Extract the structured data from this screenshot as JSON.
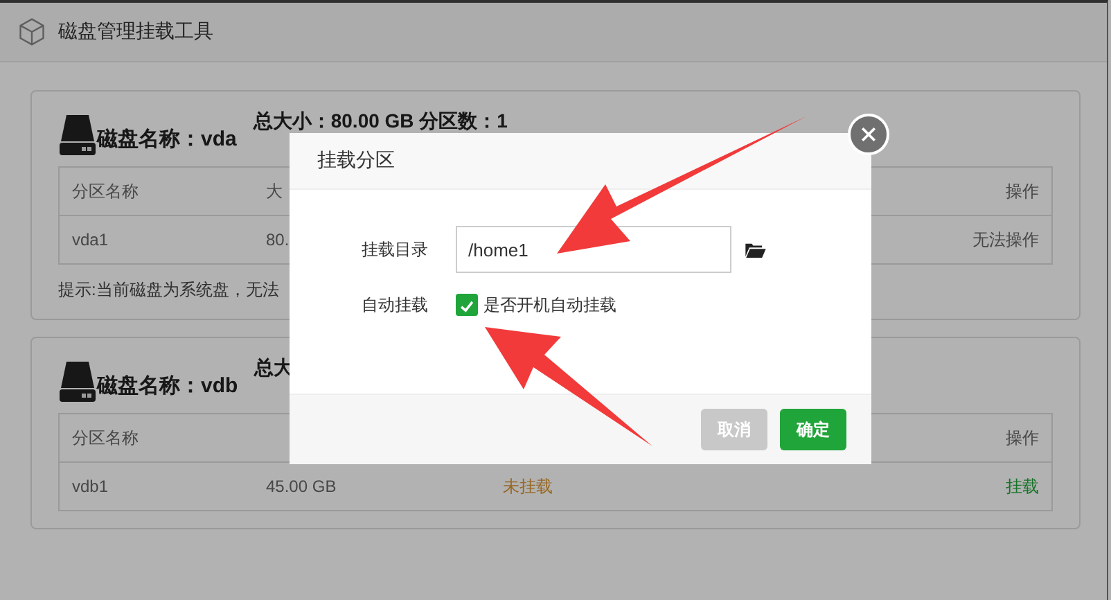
{
  "window": {
    "title": "磁盘管理挂载工具"
  },
  "disks": [
    {
      "name_label": "磁盘名称：vda",
      "summary": "总大小：80.00 GB  分区数：1",
      "columns": [
        "分区名称",
        "大",
        "",
        "",
        "操作"
      ],
      "rows": [
        {
          "name": "vda1",
          "size": "80.",
          "action": "无法操作",
          "action_enabled": false
        }
      ],
      "tip": "提示:当前磁盘为系统盘，无法"
    },
    {
      "name_label": "磁盘名称：vdb",
      "summary": "总大",
      "columns": [
        "分区名称",
        "",
        "",
        "",
        "操作"
      ],
      "rows": [
        {
          "name": "vdb1",
          "size": "45.00 GB",
          "status": "未挂载",
          "mounted": false,
          "action": "挂载",
          "action_enabled": true
        }
      ]
    }
  ],
  "dialog": {
    "title": "挂载分区",
    "dir_label": "挂载目录",
    "dir_value": "/home1",
    "auto_label": "自动挂载",
    "auto_text": "是否开机自动挂载",
    "auto_checked": true,
    "buttons": [
      {
        "label": "取消",
        "kind": "secondary"
      },
      {
        "label": "确定",
        "kind": "primary"
      }
    ]
  }
}
